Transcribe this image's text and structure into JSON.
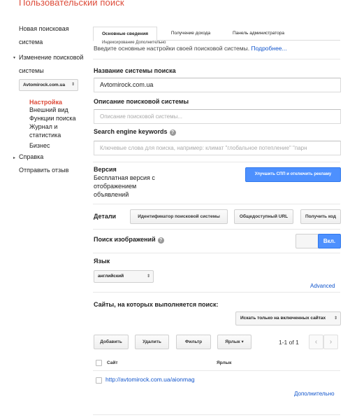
{
  "app": {
    "title": "Пользовательский поиск"
  },
  "sidebar": {
    "new_engine": [
      "Новая поисковая",
      "система"
    ],
    "edit_engine": [
      "Изменение поисковой",
      "системы"
    ],
    "site_select": "Avtomirock.com.ua",
    "sub_items": [
      "Настройка",
      "Внешний вид",
      "Функции поиска",
      "Журнал и",
      "статистика",
      "Бизнес"
    ],
    "help": "Справка",
    "feedback": "Отправить отзыв"
  },
  "tabs": [
    {
      "label": "Основные сведения",
      "active": true
    },
    {
      "label": "Получение дохода",
      "active": false
    },
    {
      "label": "Панель администратора",
      "active": false
    }
  ],
  "tab_ghost": "Индексирование      Дополнительно",
  "intro": {
    "text": "Введите основные настройки своей поисковой системы.",
    "link": "Подробнее..."
  },
  "fields": {
    "name_label": "Название системы поиска",
    "name_value": "Avtomirock.com.ua",
    "desc_label": "Описание поисковой системы",
    "desc_placeholder": "Описание поисковой системы...",
    "keywords_label": "Search engine keywords",
    "keywords_placeholder": "Ключевые слова для поиска, например: климат \"глобальное потепление\" \"парн"
  },
  "version": {
    "label": "Версия",
    "text": "Бесплатная версия с отображением объявлений",
    "upgrade_button": "Улучшить СПП и отключить рекламу"
  },
  "details": {
    "label": "Детали",
    "id_button": "Идентификатор поисковой системы",
    "public_url_button": "Общедоступный URL",
    "get_code_button": "Получить код"
  },
  "image_search": {
    "label": "Поиск изображений",
    "toggle_label": "Вкл."
  },
  "language": {
    "label": "Язык",
    "value": "английский",
    "advanced": "Advanced"
  },
  "sites": {
    "label": "Сайты, на которых выполняется поиск:",
    "scope": "Искать только на включенных сайтах",
    "buttons": {
      "add": "Добавить",
      "delete": "Удалить",
      "filter": "Фильтр",
      "label": "Ярлык"
    },
    "pager": "1-1 of 1",
    "columns": {
      "site": "Сайт",
      "label": "Ярлык"
    },
    "rows": [
      {
        "url": "http://avtomirock.com.ua/aionmag"
      }
    ],
    "more": "Дополнительно"
  },
  "colors": {
    "brand": "#dd4b39",
    "accent": "#4d90fe",
    "link": "#1155cc"
  }
}
